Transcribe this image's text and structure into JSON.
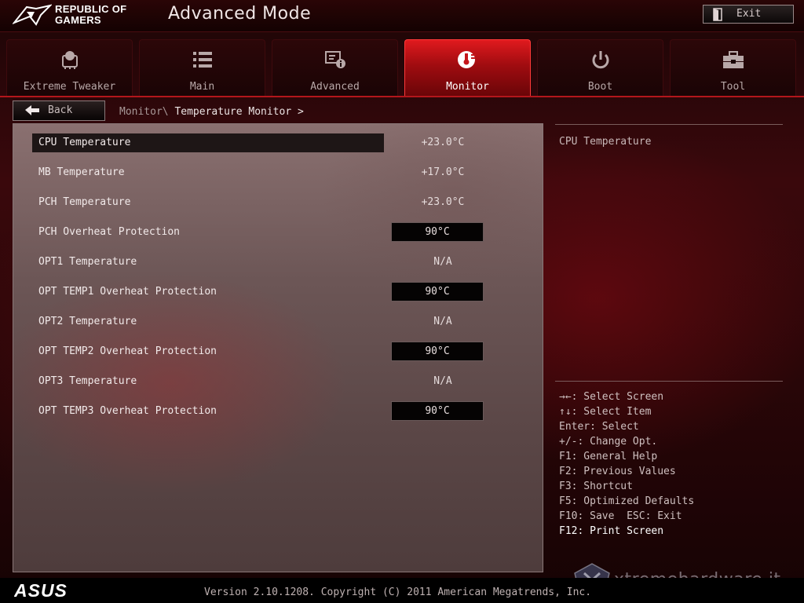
{
  "header": {
    "brand_line1": "REPUBLIC OF",
    "brand_line2": "GAMERS",
    "mode_title": "Advanced Mode",
    "exit_label": "Exit"
  },
  "tabs": [
    {
      "label": "Extreme Tweaker",
      "icon": "cooling-fan-icon",
      "active": false
    },
    {
      "label": "Main",
      "icon": "list-icon",
      "active": false
    },
    {
      "label": "Advanced",
      "icon": "settings-info-icon",
      "active": false
    },
    {
      "label": "Monitor",
      "icon": "thermometer-icon",
      "active": true
    },
    {
      "label": "Boot",
      "icon": "power-icon",
      "active": false
    },
    {
      "label": "Tool",
      "icon": "toolbox-icon",
      "active": false
    }
  ],
  "nav": {
    "back_label": "Back",
    "breadcrumb_parent": "Monitor\\ ",
    "breadcrumb_current": "Temperature Monitor >"
  },
  "items": [
    {
      "label": "CPU Temperature",
      "value": "+23.0°C",
      "editable": false,
      "selected": true
    },
    {
      "label": "MB Temperature",
      "value": "+17.0°C",
      "editable": false,
      "selected": false
    },
    {
      "label": "PCH Temperature",
      "value": "+23.0°C",
      "editable": false,
      "selected": false
    },
    {
      "label": "PCH Overheat Protection",
      "value": "90°C",
      "editable": true,
      "selected": false
    },
    {
      "label": "OPT1 Temperature",
      "value": "N/A",
      "editable": false,
      "selected": false
    },
    {
      "label": "OPT TEMP1 Overheat Protection",
      "value": "90°C",
      "editable": true,
      "selected": false
    },
    {
      "label": "OPT2 Temperature",
      "value": "N/A",
      "editable": false,
      "selected": false
    },
    {
      "label": "OPT TEMP2 Overheat Protection",
      "value": "90°C",
      "editable": true,
      "selected": false
    },
    {
      "label": "OPT3 Temperature",
      "value": "N/A",
      "editable": false,
      "selected": false
    },
    {
      "label": "OPT TEMP3 Overheat Protection",
      "value": "90°C",
      "editable": true,
      "selected": false
    }
  ],
  "help": {
    "description": "CPU Temperature",
    "keys": [
      "→←: Select Screen",
      "↑↓: Select Item",
      "Enter: Select",
      "+/-: Change Opt.",
      "F1: General Help",
      "F2: Previous Values",
      "F3: Shortcut",
      "F5: Optimized Defaults",
      "F10: Save  ESC: Exit",
      "F12: Print Screen"
    ]
  },
  "footer": {
    "brand": "ASUS",
    "version": "Version 2.10.1208. Copyright (C) 2011 American Megatrends, Inc.",
    "watermark": "xtremehardware.it"
  },
  "colors": {
    "accent": "#c4161b",
    "active_tab": "#e01a1e",
    "panel_bg": "#6c5656",
    "background": "#2a0608"
  }
}
